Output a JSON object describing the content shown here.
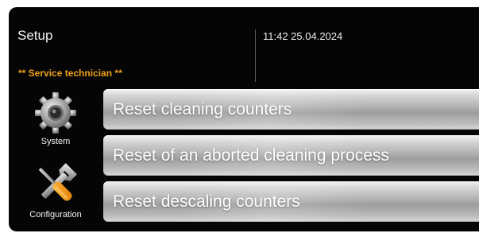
{
  "header": {
    "title": "Setup",
    "role": "** Service technician **",
    "datetime": "11:42 25.04.2024"
  },
  "nav": {
    "items": [
      {
        "label": "System",
        "icon": "gear-icon"
      },
      {
        "label": "Configuration",
        "icon": "tools-icon"
      }
    ]
  },
  "menu": {
    "items": [
      {
        "label": "Reset cleaning counters"
      },
      {
        "label": "Reset of an aborted cleaning process"
      },
      {
        "label": "Reset descaling counters"
      }
    ]
  },
  "colors": {
    "background": "#050505",
    "role_text": "#f0a21a",
    "button_silver": "#b0b0b0"
  }
}
